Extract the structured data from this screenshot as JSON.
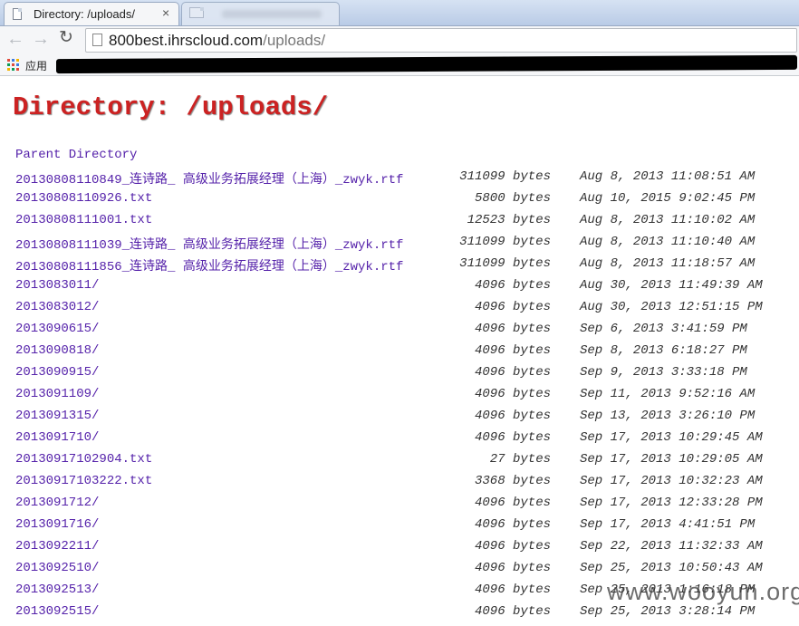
{
  "browser": {
    "active_tab_title": "Directory: /uploads/",
    "close_glyph": "×",
    "url_host": "800best.ihrscloud.com",
    "url_path": "/uploads/",
    "bookmarks_apps_label": "应用"
  },
  "page": {
    "heading": "Directory: /uploads/",
    "parent_link": "Parent Directory",
    "entries": [
      {
        "name": "20130808110849_连诗路_ 高级业务拓展经理（上海）_zwyk.rtf",
        "size": "311099 bytes",
        "date": "Aug 8, 2013 11:08:51 AM"
      },
      {
        "name": "20130808110926.txt",
        "size": "5800 bytes",
        "date": "Aug 10, 2015 9:02:45 PM"
      },
      {
        "name": "20130808111001.txt",
        "size": "12523 bytes",
        "date": "Aug 8, 2013 11:10:02 AM"
      },
      {
        "name": "20130808111039_连诗路_ 高级业务拓展经理（上海）_zwyk.rtf",
        "size": "311099 bytes",
        "date": "Aug 8, 2013 11:10:40 AM"
      },
      {
        "name": "20130808111856_连诗路_ 高级业务拓展经理（上海）_zwyk.rtf",
        "size": "311099 bytes",
        "date": "Aug 8, 2013 11:18:57 AM"
      },
      {
        "name": "2013083011/",
        "size": "4096 bytes",
        "date": "Aug 30, 2013 11:49:39 AM"
      },
      {
        "name": "2013083012/",
        "size": "4096 bytes",
        "date": "Aug 30, 2013 12:51:15 PM"
      },
      {
        "name": "2013090615/",
        "size": "4096 bytes",
        "date": "Sep 6, 2013 3:41:59 PM"
      },
      {
        "name": "2013090818/",
        "size": "4096 bytes",
        "date": "Sep 8, 2013 6:18:27 PM"
      },
      {
        "name": "2013090915/",
        "size": "4096 bytes",
        "date": "Sep 9, 2013 3:33:18 PM"
      },
      {
        "name": "2013091109/",
        "size": "4096 bytes",
        "date": "Sep 11, 2013 9:52:16 AM"
      },
      {
        "name": "2013091315/",
        "size": "4096 bytes",
        "date": "Sep 13, 2013 3:26:10 PM"
      },
      {
        "name": "2013091710/",
        "size": "4096 bytes",
        "date": "Sep 17, 2013 10:29:45 AM"
      },
      {
        "name": "20130917102904.txt",
        "size": "27 bytes",
        "date": "Sep 17, 2013 10:29:05 AM"
      },
      {
        "name": "20130917103222.txt",
        "size": "3368 bytes",
        "date": "Sep 17, 2013 10:32:23 AM"
      },
      {
        "name": "2013091712/",
        "size": "4096 bytes",
        "date": "Sep 17, 2013 12:33:28 PM"
      },
      {
        "name": "2013091716/",
        "size": "4096 bytes",
        "date": "Sep 17, 2013 4:41:51 PM"
      },
      {
        "name": "2013092211/",
        "size": "4096 bytes",
        "date": "Sep 22, 2013 11:32:33 AM"
      },
      {
        "name": "2013092510/",
        "size": "4096 bytes",
        "date": "Sep 25, 2013 10:50:43 AM"
      },
      {
        "name": "2013092513/",
        "size": "4096 bytes",
        "date": "Sep 25, 2013 1:16:18 PM"
      },
      {
        "name": "2013092515/",
        "size": "4096 bytes",
        "date": "Sep 25, 2013 3:28:14 PM"
      }
    ]
  },
  "watermark": "www.wooyun.org",
  "colors": {
    "heading": "#cc2222",
    "link": "#5522aa"
  }
}
